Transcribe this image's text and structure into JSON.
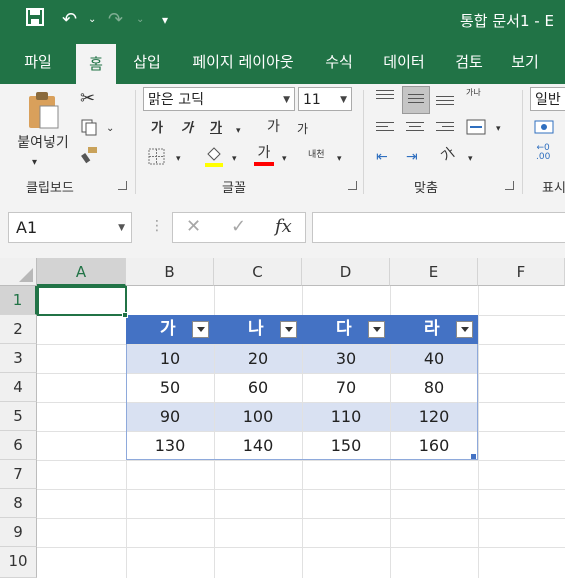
{
  "window": {
    "title": "통합 문서1 - E"
  },
  "menu": {
    "tabs": [
      "파일",
      "홈",
      "삽입",
      "페이지 레이아웃",
      "수식",
      "데이터",
      "검토",
      "보기"
    ],
    "active": "홈"
  },
  "ribbon": {
    "clipboard": {
      "label": "클립보드",
      "paste_label": "붙여넣기"
    },
    "font": {
      "label": "글꼴",
      "font_name": "맑은 고딕",
      "font_size": "11",
      "bold": "가",
      "italic": "가",
      "underline": "가",
      "grow": "가",
      "shrink": "가",
      "font_color": "가",
      "phonetic": "내천"
    },
    "alignment": {
      "label": "맞춤",
      "wrap": "가나",
      "orientation": "가"
    },
    "number": {
      "label": "표시",
      "format": "일반"
    }
  },
  "formula_bar": {
    "name_box": "A1",
    "fx": "fx",
    "cancel": "✕",
    "enter": "✓",
    "formula": ""
  },
  "grid": {
    "columns": [
      "A",
      "B",
      "C",
      "D",
      "E",
      "F"
    ],
    "rows": [
      "1",
      "2",
      "3",
      "4",
      "5",
      "6",
      "7",
      "8",
      "9",
      "10"
    ],
    "table": {
      "headers": [
        "가",
        "나",
        "다",
        "라"
      ],
      "rows": [
        [
          "10",
          "20",
          "30",
          "40"
        ],
        [
          "50",
          "60",
          "70",
          "80"
        ],
        [
          "90",
          "100",
          "110",
          "120"
        ],
        [
          "130",
          "140",
          "150",
          "160"
        ]
      ]
    },
    "colors": {
      "header": "#4472c4",
      "band": "#d9e1f2",
      "accent": "#217346"
    }
  }
}
